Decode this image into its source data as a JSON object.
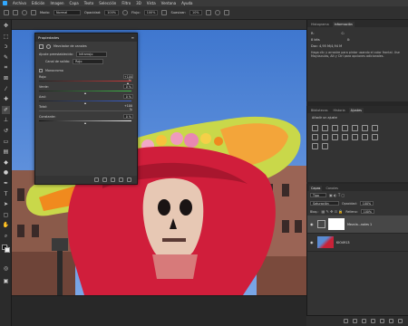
{
  "menubar": {
    "items": [
      "Archivo",
      "Edición",
      "Imagen",
      "Capa",
      "Texto",
      "Selección",
      "Filtro",
      "3D",
      "Vista",
      "Ventana",
      "Ayuda"
    ]
  },
  "options": {
    "mode_label": "Modo:",
    "mode_value": "Normal",
    "opacity_label": "Opacidad:",
    "opacity_value": "100%",
    "flow_label": "Flujo:",
    "flow_value": "100%",
    "smoothing_label": "Suavizar:",
    "smoothing_value": "10%"
  },
  "properties": {
    "title": "Propiedades",
    "adjustment_name": "Mezclador de canales",
    "preset_label": "Ajuste preestablecido:",
    "preset_value": "Infrarrojo",
    "output_label": "Canal de salida:",
    "output_value": "Rojo",
    "monochrome_label": "Monocromo",
    "sliders": [
      {
        "label": "Rojo:",
        "value": "+100 %",
        "fraction": 0.98,
        "color": "#d23b3b"
      },
      {
        "label": "Verde:",
        "value": "0 %",
        "fraction": 0.5,
        "color": "#3fbf4a"
      },
      {
        "label": "Azul:",
        "value": "0 %",
        "fraction": 0.5,
        "color": "#3b63d6"
      },
      {
        "label": "Total:",
        "value": "+100 %",
        "fraction": 0.98,
        "color": "#bbbbbb"
      },
      {
        "label": "Constante:",
        "value": "0 %",
        "fraction": 0.5,
        "color": "#777777"
      }
    ]
  },
  "right": {
    "top_tabs": [
      "Histograma",
      "Información"
    ],
    "info": {
      "row1_left": "R:",
      "row1_right": "C:",
      "row2_left": "8 bits",
      "row2_right": "X:",
      "row3_left": "Doc: 4,95 M/4,94 M",
      "help": "Haga clic y arrastre para pintar usando el color frontal. Use Mayúsculas, Alt y Ctrl para opciones adicionales."
    },
    "mid_tabs": [
      "Bibliotecas",
      "Historia",
      "Ajustes"
    ],
    "adjust_add": "Añadir un ajuste",
    "layer_tabs": [
      "Capas",
      "Canales"
    ],
    "layer_kind": "Tipo",
    "layer_blend": "Saturación",
    "opacity_label": "Opacidad:",
    "opacity_value": "100%",
    "lock_label": "Bloq.:",
    "fill_label": "Relleno:",
    "fill_value": "100%",
    "layers": [
      {
        "name": "Mezcla...nales 1",
        "selected": true
      },
      {
        "name": "KIO4913",
        "selected": false
      }
    ]
  }
}
